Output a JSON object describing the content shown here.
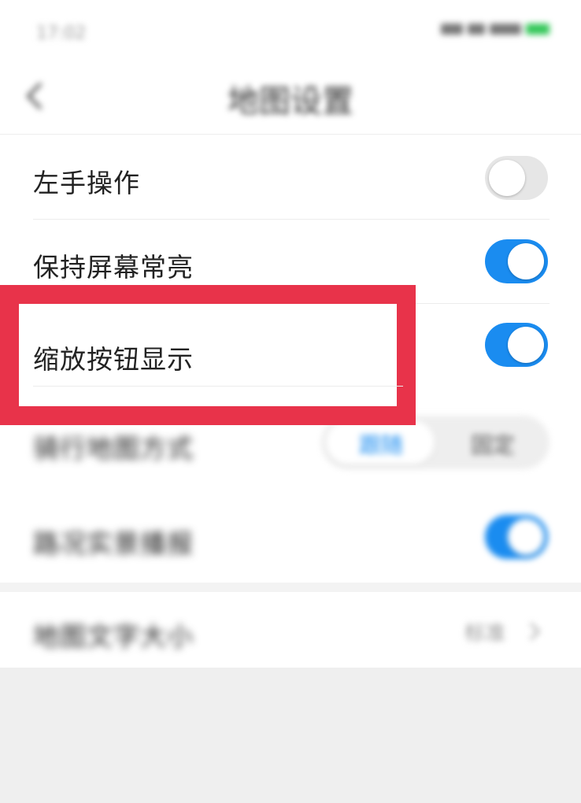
{
  "status_bar": {
    "time": "17:02"
  },
  "nav": {
    "title": "地图设置",
    "back_icon": "back-arrow-icon"
  },
  "settings": {
    "left_hand": {
      "label": "左手操作",
      "on": false
    },
    "keep_screen_on": {
      "label": "保持屏幕常亮",
      "on": true
    },
    "zoom_buttons": {
      "label": "缩放按钮显示",
      "on": true
    },
    "map_mode": {
      "label": "骑行地图方式",
      "options": [
        "跟随",
        "固定"
      ],
      "selected": "跟随"
    },
    "traffic": {
      "label": "路况实景播报",
      "on": true
    },
    "font_size": {
      "label": "地图文字大小",
      "value": "标准"
    }
  },
  "colors": {
    "accent": "#1a8cf0",
    "highlight": "#e8334a",
    "toggle_off": "#e6e6e6"
  }
}
